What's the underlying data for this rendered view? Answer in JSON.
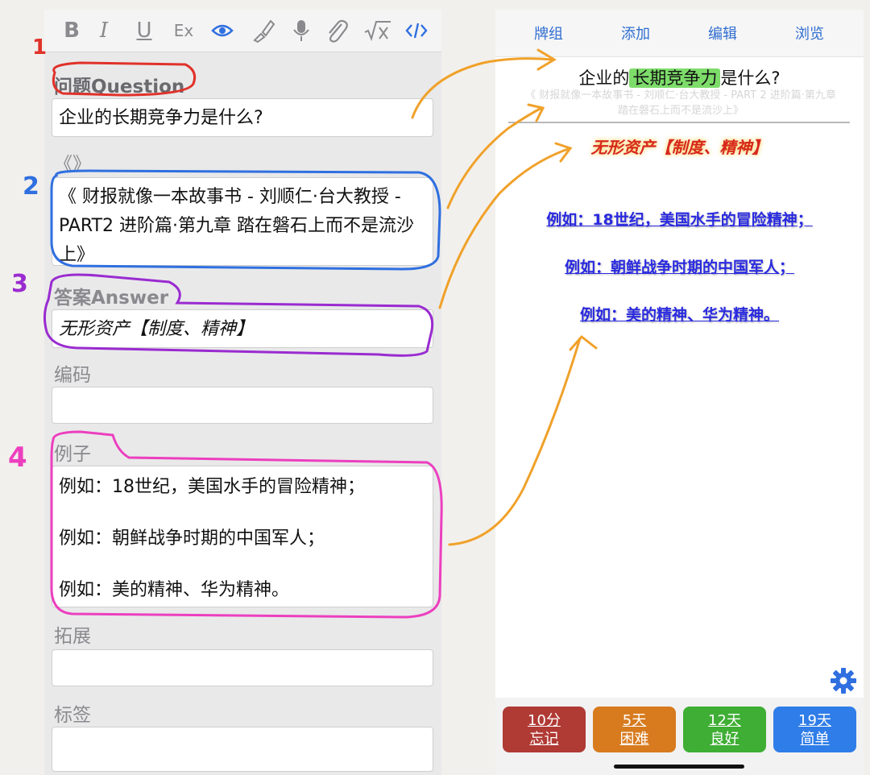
{
  "editor": {
    "toolbar": {
      "bold": "B",
      "italic": "I",
      "underline": "U",
      "clear_format": "Ex"
    },
    "fields": [
      {
        "label": "问题Question",
        "value": "企业的长期竞争力是什么?"
      },
      {
        "label": "《》",
        "value": "《 财报就像一本故事书 - 刘顺仁·台大教授 - PART2 进阶篇·第九章 踏在磐石上而不是流沙上》"
      },
      {
        "label": "答案Answer",
        "value": "无形资产【制度、精神】"
      },
      {
        "label": "编码",
        "value": ""
      },
      {
        "label": "例子",
        "lines": [
          "例如：18世纪，美国水手的冒险精神；",
          "例如：朝鲜战争时期的中国军人；",
          "例如：美的精神、华为精神。"
        ]
      },
      {
        "label": "拓展",
        "value": ""
      },
      {
        "label": "标签",
        "value": ""
      }
    ]
  },
  "annotations": {
    "numbers": [
      "1",
      "2",
      "3",
      "4"
    ],
    "colors": {
      "one": "#e0322a",
      "two": "#2f6fe0",
      "three": "#9a2bd0",
      "four": "#ec3fbf",
      "arrows": "#f0a12a"
    }
  },
  "preview": {
    "nav": [
      "牌组",
      "添加",
      "编辑",
      "浏览"
    ],
    "question_prefix": "企业的",
    "question_highlight": "长期竞争力",
    "question_suffix": "是什么?",
    "source_line1": "《 财报就像一本故事书 - 刘顺仁·台大教授 - PART 2 进阶篇·第九章",
    "source_line2": "踏在磐石上而不是流沙上》",
    "answer": "无形资产【制度、精神】",
    "examples": [
      "例如：18世纪，美国水手的冒险精神；",
      "例如：朝鲜战争时期的中国军人；",
      "例如：美的精神、华为精神。"
    ],
    "grades": [
      {
        "interval": "10分",
        "label": "忘记",
        "color": "#b03a34"
      },
      {
        "interval": "5天",
        "label": "困难",
        "color": "#d77b1e"
      },
      {
        "interval": "12天",
        "label": "良好",
        "color": "#3fae34"
      },
      {
        "interval": "19天",
        "label": "简单",
        "color": "#2f7de8"
      }
    ]
  }
}
